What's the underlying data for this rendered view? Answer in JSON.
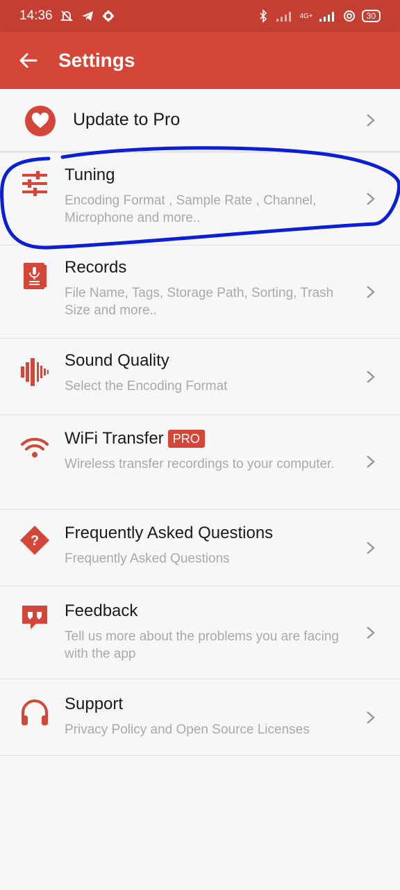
{
  "status_bar": {
    "time": "14:36",
    "battery": "30",
    "network": "4G+"
  },
  "app_bar": {
    "title": "Settings"
  },
  "pro": {
    "label": "Update to Pro"
  },
  "items": [
    {
      "title": "Tuning",
      "subtitle": "Encoding Format , Sample Rate , Channel, Microphone and more..",
      "icon": "tuning-sliders-icon"
    },
    {
      "title": "Records",
      "subtitle": "File Name, Tags, Storage Path, Sorting, Trash Size and more..",
      "icon": "records-book-icon"
    },
    {
      "title": "Sound Quality",
      "subtitle": "Select the Encoding Format",
      "icon": "sound-wave-icon"
    },
    {
      "title": "WiFi Transfer",
      "badge": "PRO",
      "subtitle": "Wireless transfer recordings to your computer.",
      "icon": "wifi-icon"
    },
    {
      "title": "Frequently Asked Questions",
      "subtitle": "Frequently Asked Questions",
      "icon": "question-diamond-icon"
    },
    {
      "title": "Feedback",
      "subtitle": "Tell us more about the problems you are facing with the app",
      "icon": "feedback-quote-icon"
    },
    {
      "title": "Support",
      "subtitle": "Privacy Policy and Open Source Licenses",
      "icon": "headphones-icon"
    }
  ],
  "colors": {
    "accent": "#d44638",
    "status_bar": "#c43e32",
    "annotation": "#0a1fd6"
  }
}
